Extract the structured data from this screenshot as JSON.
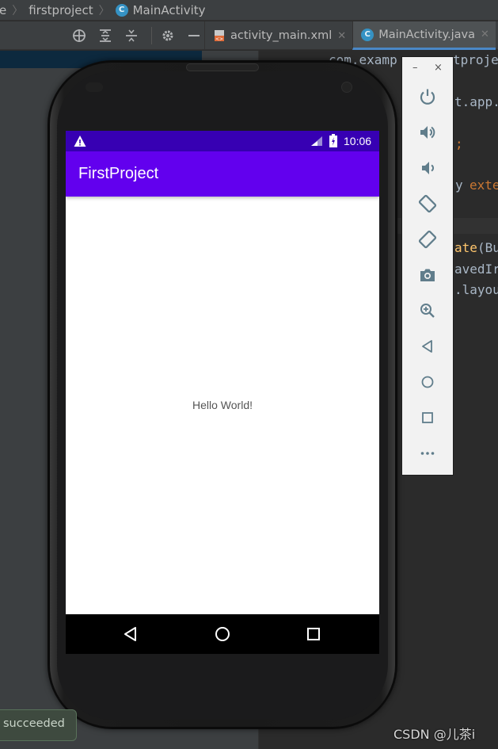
{
  "breadcrumb": {
    "items": [
      "e",
      "firstproject",
      "MainActivity"
    ]
  },
  "toolbar": {
    "icons": [
      "crosshair-icon",
      "expand-all-icon",
      "collapse-all-icon",
      "gear-icon",
      "minimize-icon"
    ]
  },
  "tabs": [
    {
      "label": "activity_main.xml",
      "icon": "xml-layout-icon",
      "active": false
    },
    {
      "label": "MainActivity.java",
      "icon": "java-class-icon",
      "active": true
    }
  ],
  "editor": {
    "lines": [
      {
        "text": "com.examp",
        "color": "#a9b7c6"
      },
      {
        "text": "tproje",
        "color": "#a9b7c6"
      },
      {
        "text": "t.app.",
        "color": "#a9b7c6"
      },
      {
        "text": ";",
        "color": "#cc7832"
      },
      {
        "text": "y ",
        "color": "#a9b7c6"
      },
      {
        "text": "exte",
        "color": "#cc7832"
      },
      {
        "text": "ate",
        "color": "#ffc66d"
      },
      {
        "text": "(Bu",
        "color": "#a9b7c6"
      },
      {
        "text": "avedIr",
        "color": "#a9b7c6"
      },
      {
        "text": ".layou",
        "color": "#a9b7c6"
      }
    ]
  },
  "emulator": {
    "status_bar": {
      "time": "10:06",
      "color": "#3700b3"
    },
    "app_bar": {
      "title": "FirstProject",
      "color": "#6200ee"
    },
    "content": {
      "hello_text": "Hello World!"
    },
    "nav_buttons": [
      "back-icon",
      "home-icon",
      "recents-icon"
    ]
  },
  "emulator_toolbar": {
    "minimize_label": "–",
    "close_label": "×",
    "buttons": [
      "power-icon",
      "volume-up-icon",
      "volume-down-icon",
      "rotate-left-icon",
      "rotate-right-icon",
      "camera-icon",
      "zoom-icon",
      "back-icon",
      "home-icon",
      "overview-icon",
      "more-icon"
    ]
  },
  "build_toast": {
    "text": "succeeded"
  },
  "watermark": {
    "text": "CSDN @儿茶i"
  }
}
